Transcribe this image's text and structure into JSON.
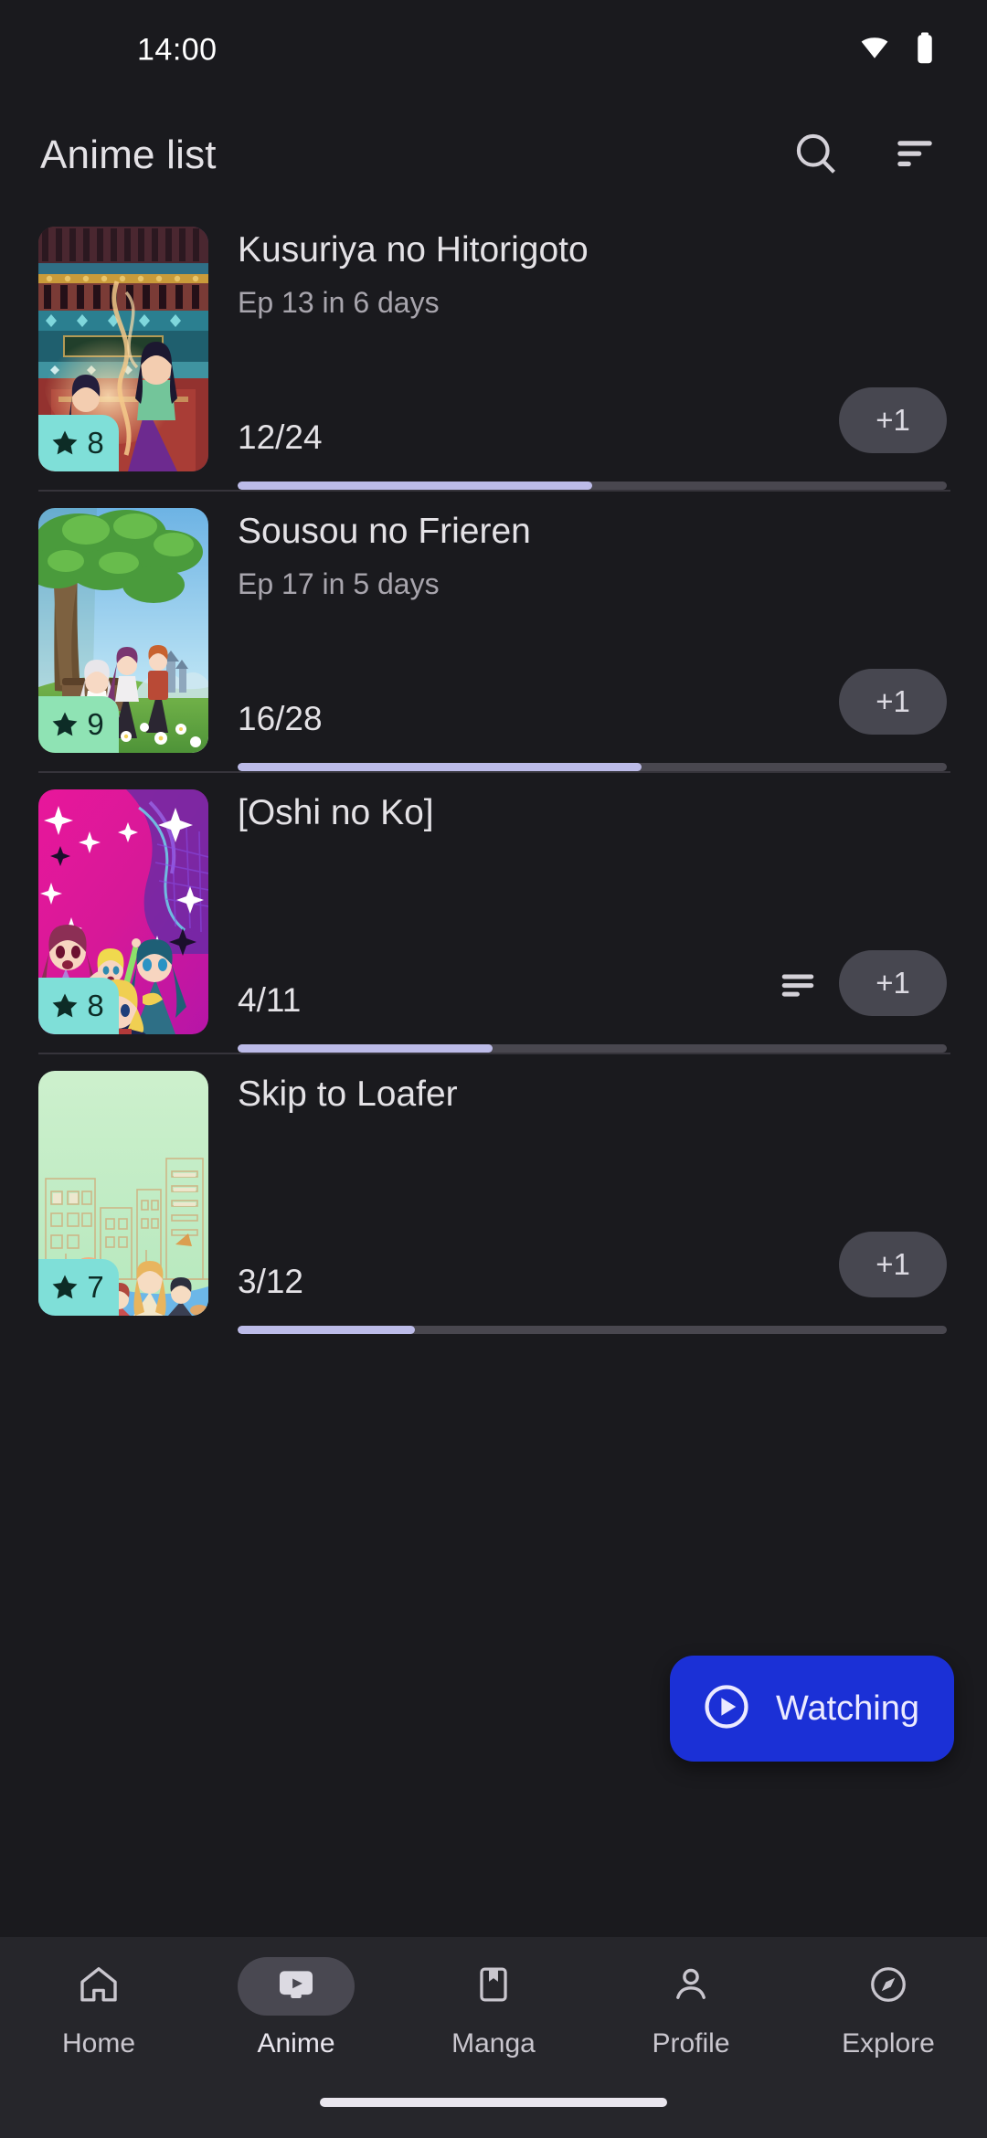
{
  "status_bar": {
    "time": "14:00",
    "icons": [
      "wifi-icon",
      "battery-icon"
    ]
  },
  "app_bar": {
    "title": "Anime list",
    "search_icon": "search-icon",
    "sort_icon": "sort-icon"
  },
  "colors": {
    "background": "#1a1a1e",
    "surface": "#26262b",
    "progress_fill": "#bcbbe8",
    "progress_track": "#49474f",
    "plus_button": "#474750",
    "fab": "#1b30d6",
    "divider": "#36343b",
    "text_primary": "#e4e2e6",
    "text_secondary": "#a8a5ad"
  },
  "list": {
    "items": [
      {
        "title": "Kusuriya no Hitorigoto",
        "subtitle": "Ep 13 in 6 days",
        "score": "8",
        "score_badge_color": "#7fdfd8",
        "progress_text": "12/24",
        "progress_current": 12,
        "progress_total": 24,
        "progress_percent": 50,
        "increment_label": "+1",
        "has_notes_icon": false
      },
      {
        "title": "Sousou no Frieren",
        "subtitle": "Ep 17 in 5 days",
        "score": "9",
        "score_badge_color": "#8fe3b4",
        "progress_text": "16/28",
        "progress_current": 16,
        "progress_total": 28,
        "progress_percent": 57,
        "increment_label": "+1",
        "has_notes_icon": false
      },
      {
        "title": "[Oshi no Ko]",
        "subtitle": "",
        "score": "8",
        "score_badge_color": "#7fdfd8",
        "progress_text": "4/11",
        "progress_current": 4,
        "progress_total": 11,
        "progress_percent": 36,
        "increment_label": "+1",
        "has_notes_icon": true
      },
      {
        "title": "Skip to Loafer",
        "subtitle": "",
        "score": "7",
        "score_badge_color": "#7fdfd8",
        "progress_text": "3/12",
        "progress_current": 3,
        "progress_total": 12,
        "progress_percent": 25,
        "increment_label": "+1",
        "has_notes_icon": false
      }
    ]
  },
  "fab": {
    "label": "Watching",
    "icon": "play-circle-icon"
  },
  "bottom_nav": {
    "items": [
      {
        "label": "Home",
        "icon": "home-icon",
        "active": false
      },
      {
        "label": "Anime",
        "icon": "smart-display-icon",
        "active": true
      },
      {
        "label": "Manga",
        "icon": "book-icon",
        "active": false
      },
      {
        "label": "Profile",
        "icon": "person-icon",
        "active": false
      },
      {
        "label": "Explore",
        "icon": "compass-icon",
        "active": false
      }
    ]
  }
}
